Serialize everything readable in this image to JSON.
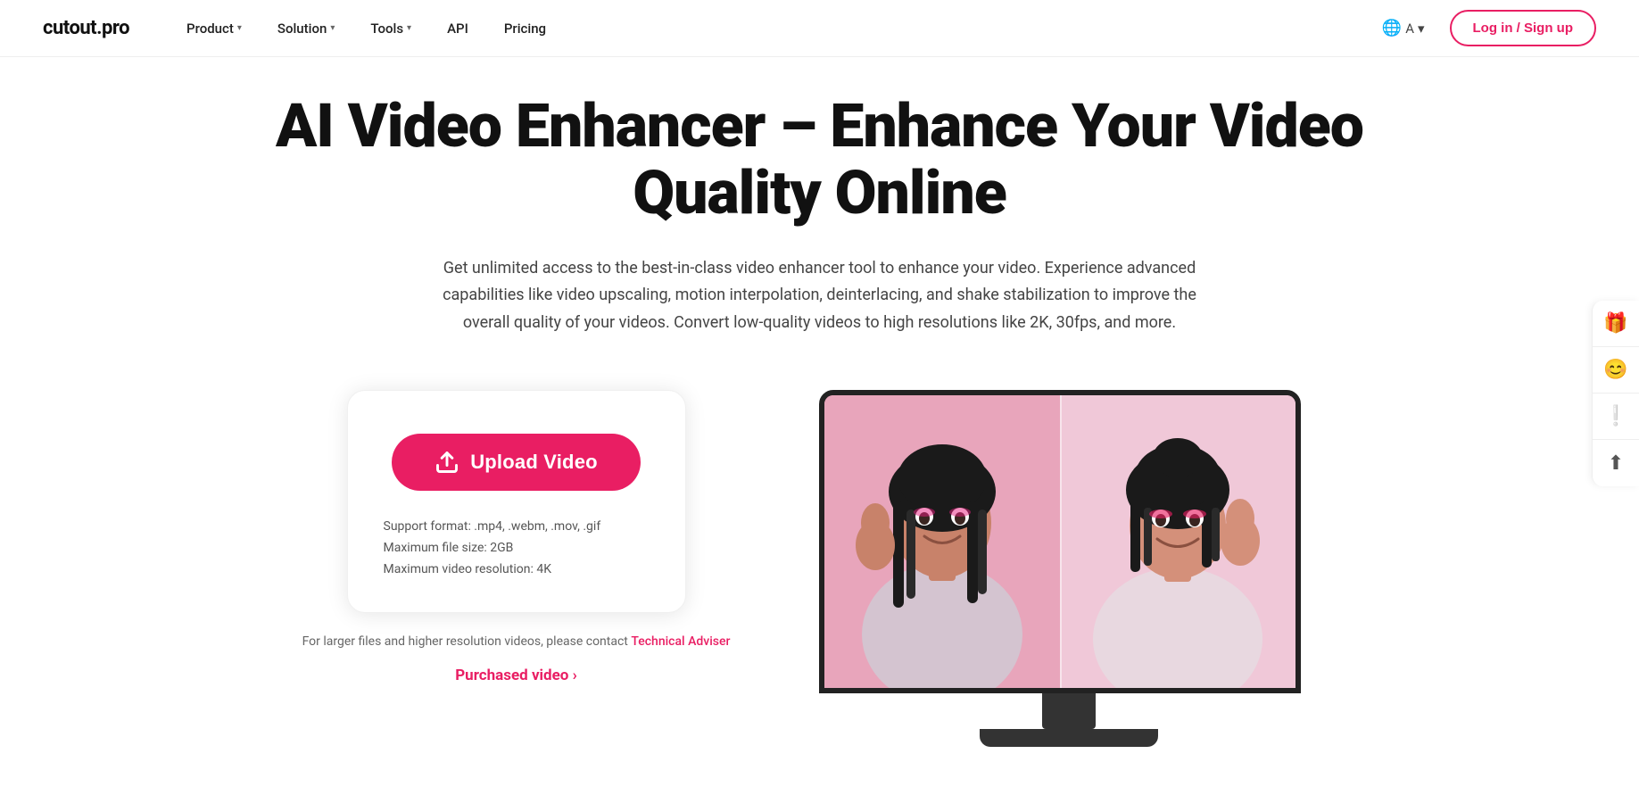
{
  "logo": {
    "text": "cutout.pro"
  },
  "nav": {
    "items": [
      {
        "label": "Product",
        "hasDropdown": true
      },
      {
        "label": "Solution",
        "hasDropdown": true
      },
      {
        "label": "Tools",
        "hasDropdown": true
      },
      {
        "label": "API",
        "hasDropdown": false
      },
      {
        "label": "Pricing",
        "hasDropdown": false
      }
    ],
    "translate_label": "A",
    "login_label": "Log in / Sign up"
  },
  "hero": {
    "title": "AI Video Enhancer – Enhance Your Video Quality Online",
    "description": "Get unlimited access to the best-in-class video enhancer tool to enhance your video. Experience advanced capabilities like video upscaling, motion interpolation, deinterlacing, and shake stabilization to improve the overall quality of your videos. Convert low-quality videos to high resolutions like 2K, 30fps, and more."
  },
  "upload": {
    "button_label": "Upload Video",
    "format_label": "Support format: .mp4, .webm, .mov, .gif",
    "size_label": "Maximum file size: 2GB",
    "resolution_label": "Maximum video resolution: 4K",
    "note_prefix": "For larger files and higher resolution videos, please contact ",
    "note_link": "Technical Adviser",
    "purchased_label": "Purchased video ›"
  },
  "sidebar": {
    "icons": [
      {
        "name": "gift",
        "symbol": "🎁"
      },
      {
        "name": "face",
        "symbol": "😊"
      },
      {
        "name": "alert",
        "symbol": "❗"
      },
      {
        "name": "top",
        "symbol": "⬆"
      }
    ]
  }
}
